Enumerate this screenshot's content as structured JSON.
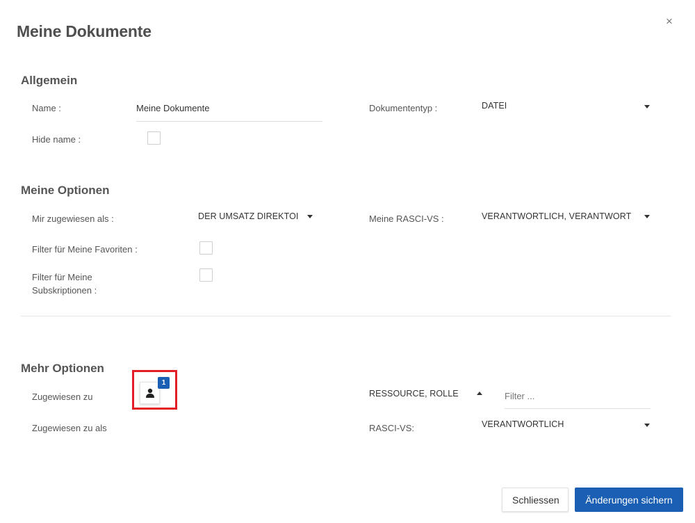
{
  "dialog": {
    "title": "Meine Dokumente",
    "close_glyph": "×"
  },
  "allgemein": {
    "heading": "Allgemein",
    "name_label": "Name :",
    "name_value": "Meine Dokumente",
    "doctype_label": "Dokumententyp :",
    "doctype_value": "DATEI",
    "hide_name_label": "Hide name :",
    "hide_name_checked": false
  },
  "meine_optionen": {
    "heading": "Meine Optionen",
    "assigned_as_label": "Mir zugewiesen als :",
    "assigned_as_value": "DER UMSATZ DIREKTOI",
    "rasci_label": "Meine RASCI-VS :",
    "rasci_value": "VERANTWORTLICH, VERANTWORT",
    "favorites_label": "Filter für Meine Favoriten :",
    "favorites_checked": false,
    "subscriptions_label_line1": "Filter für Meine",
    "subscriptions_label_line2": "Subskriptionen :",
    "subscriptions_checked": false
  },
  "mehr_optionen": {
    "heading": "Mehr Optionen",
    "assigned_to_label": "Zugewiesen zu",
    "assigned_to_count": "1",
    "resource_role_value": "RESSOURCE, ROLLE",
    "filter_placeholder": "Filter ...",
    "assigned_to_as_label": "Zugewiesen zu als",
    "rasci_vs_label": "RASCI-VS:",
    "rasci_vs_value": "VERANTWORTLICH"
  },
  "footer": {
    "close_label": "Schliessen",
    "save_label": "Änderungen sichern"
  },
  "colors": {
    "primary": "#1a5fb4",
    "highlight": "#e41e26"
  },
  "icons": {
    "close": "close-icon",
    "person": "person-icon",
    "caret": "caret-down-icon"
  }
}
